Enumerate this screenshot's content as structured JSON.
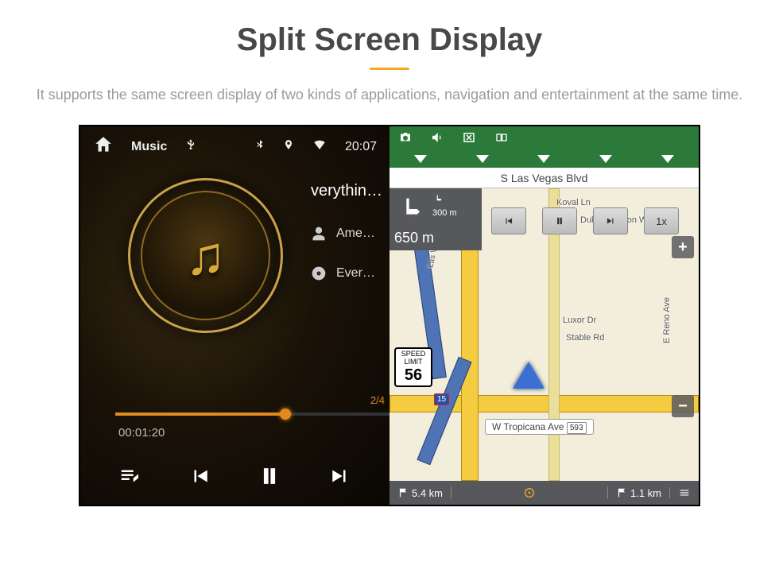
{
  "hero": {
    "title": "Split Screen Display",
    "desc": "It supports the same screen display of two kinds of applications, navigation and entertainment at the same time."
  },
  "statusbar": {
    "clock": "20:07"
  },
  "music": {
    "app_title": "Music",
    "track": "verythin…",
    "artist": "Ame…",
    "album": "Ever…",
    "elapsed": "00:01:20",
    "counter": "2/4",
    "progress_pct": 62
  },
  "nav": {
    "top_street": "S Las Vegas Blvd",
    "turn_sub_dist": "300 m",
    "turn_main_dist": "650 m",
    "playback_speed": "1x",
    "speed_limit_label": "SPEED LIMIT",
    "speed_limit": "56",
    "current_street": "W Tropicana Ave",
    "route_marker": "593",
    "hwy_shield": "15",
    "labels": {
      "koval": "Koval Ln",
      "duke": "Duke Ellington Way",
      "luxor": "Luxor Dr",
      "stable": "Stable Rd",
      "reno": "E Reno Ave",
      "vegas_strip": "Las Vegas Strip"
    },
    "bottom": {
      "left_val": "5.4 km",
      "right_val": "1.1 km"
    }
  }
}
